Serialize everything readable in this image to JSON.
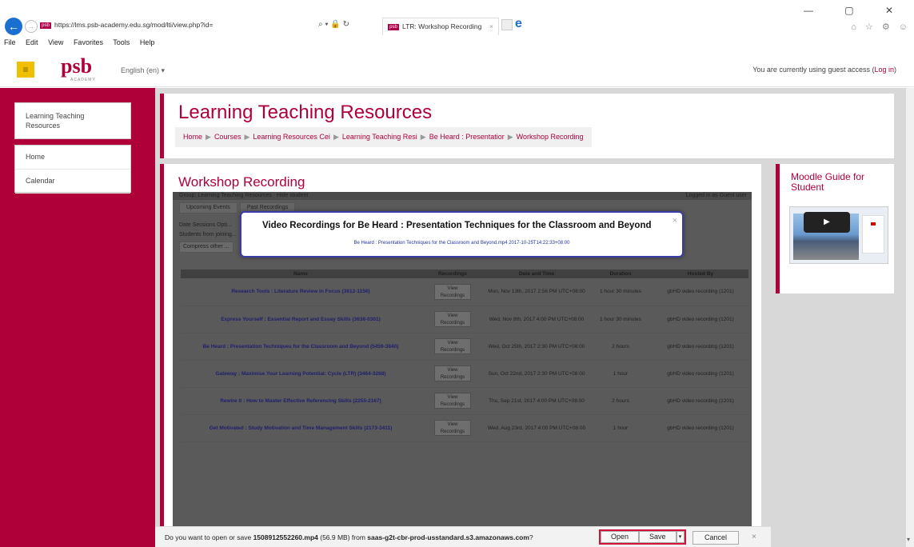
{
  "browser": {
    "url": "https://lms.psb-academy.edu.sg/mod/lti/view.php?id=",
    "tab_title": "LTR: Workshop Recording",
    "tab_favicon": "psb",
    "menu": [
      "File",
      "Edit",
      "View",
      "Favorites",
      "Tools",
      "Help"
    ],
    "window_controls": "— ▢ ✕"
  },
  "header": {
    "logo": "psb",
    "logo_sub": "ACADEMY",
    "language": "English (en) ▾",
    "guest_text": "You are currently using guest access (",
    "login_link": "Log in",
    "guest_close": ")"
  },
  "sidebar": {
    "top_item": "Learning Teaching Resources",
    "items": [
      "Home",
      "Calendar"
    ]
  },
  "main": {
    "title": "Learning Teaching Resources",
    "breadcrumb": [
      "Home",
      "Courses",
      "Learning Resources Cei",
      "Learning Teaching Resi",
      "Be Heard : Presentatior",
      "Workshop Recording"
    ]
  },
  "content": {
    "title": "Workshop Recording",
    "lti_top_left": "Group: Learning Teaching Resources · Hide student",
    "lti_top_right": "Logged in as Guest user",
    "lti_tabs": [
      "Upcoming Events",
      "Past Recordings"
    ],
    "lti_filter": [
      "Date Sessions Opti...",
      "Students from joining..."
    ],
    "lti_filter_button": "Compress other ...",
    "table": {
      "headers": [
        "Name",
        "Recordings",
        "Date and Time",
        "Duration",
        "Hosted By"
      ],
      "rows": [
        {
          "name": "Research Tools : Literature Review in Focus (3612-1156)",
          "rec": "View Recordings",
          "date": "Mon, Nov 13th, 2017 2:56 PM UTC+08:00",
          "dur": "1 hour 30 minutes",
          "host": "gbHD video recording (1201)"
        },
        {
          "name": "Express Yourself : Essential Report and Essay Skills (3638-0301)",
          "rec": "View Recordings",
          "date": "Wed, Nov 8th, 2017 4:00 PM UTC+08:00",
          "dur": "1 hour 30 minutes",
          "host": "gbHD video recording (1201)"
        },
        {
          "name": "Be Heard : Presentation Techniques for the Classroom and Beyond (5459-3840)",
          "rec": "View Recordings",
          "date": "Wed, Oct 25th, 2017 2:30 PM UTC+08:00",
          "dur": "2 hours",
          "host": "gbHD video recording (1201)"
        },
        {
          "name": "Gateway : Maximise Your Learning Potential: Cycle (LTR) (3464-3268)",
          "rec": "View Recordings",
          "date": "Sun, Oct 22nd, 2017 2:30 PM UTC+08:00",
          "dur": "1 hour",
          "host": "gbHD video recording (1201)"
        },
        {
          "name": "Rewire It : How to Master Effective Referencing Skills (2255-2167)",
          "rec": "View Recordings",
          "date": "Thu, Sep 21st, 2017 4:00 PM UTC+08:00",
          "dur": "2 hours",
          "host": "gbHD video recording (1201)"
        },
        {
          "name": "Get Motivated : Study Motivation and Time Management Skills (2173-3411)",
          "rec": "View Recordings",
          "date": "Wed, Aug 23rd, 2017 4:00 PM UTC+08:00",
          "dur": "1 hour",
          "host": "gbHD video recording (1201)"
        }
      ]
    }
  },
  "modal": {
    "title": "Video Recordings for Be Heard : Presentation Techniques for the Classroom and Beyond",
    "link": "Be Heard : Presentation Techniques for the Classroom and Beyond.mp4 2017-10-25T14:22:33+08:00",
    "close": "×"
  },
  "right": {
    "title": "Moodle Guide for Student"
  },
  "download": {
    "prefix": "Do you want to open or save ",
    "filename": "1508912552260.mp4",
    "size": " (56.9 MB) from ",
    "host": "saas-g2t-cbr-prod-usstandard.s3.amazonaws.com",
    "suffix": "?",
    "open": "Open",
    "save": "Save",
    "cancel": "Cancel",
    "close": "×"
  },
  "colors": {
    "brand": "#b0003a",
    "highlight": "#d4123a",
    "modal_border": "#3c3ca8"
  }
}
